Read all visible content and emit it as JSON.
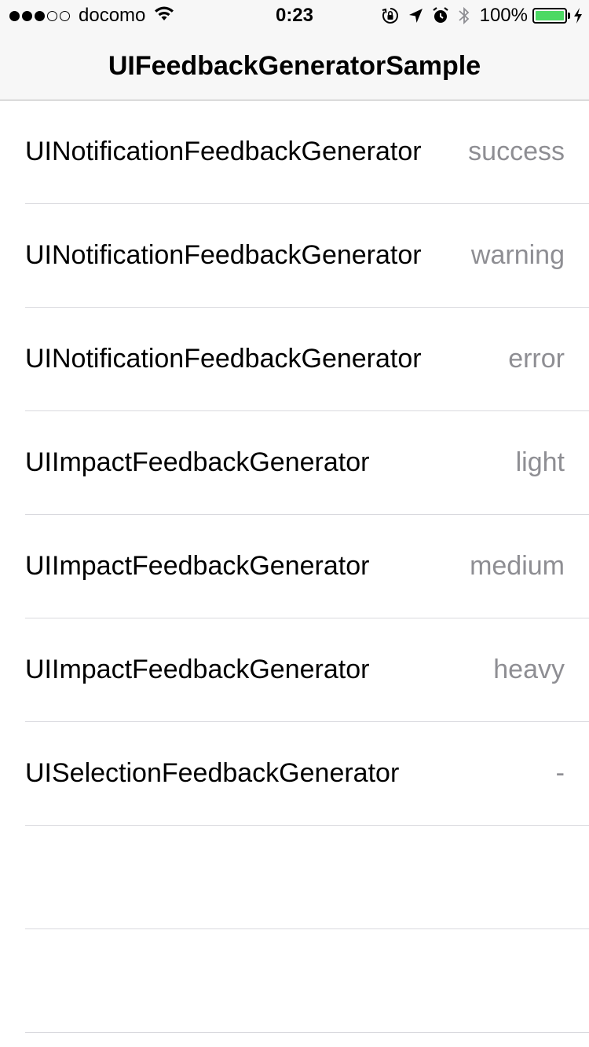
{
  "status_bar": {
    "carrier": "docomo",
    "signal_bars_full": 3,
    "signal_bars_total": 5,
    "time": "0:23",
    "battery_percent": "100%",
    "icons": [
      "wifi-icon",
      "rotation-lock-icon",
      "location-arrow-icon",
      "alarm-icon",
      "bluetooth-icon",
      "battery-icon",
      "charging-bolt-icon"
    ],
    "battery_fill_color": "#4cd964"
  },
  "nav": {
    "title": "UIFeedbackGeneratorSample"
  },
  "rows": [
    {
      "title": "UINotificationFeedbackGenerator",
      "detail": "success"
    },
    {
      "title": "UINotificationFeedbackGenerator",
      "detail": "warning"
    },
    {
      "title": "UINotificationFeedbackGenerator",
      "detail": "error"
    },
    {
      "title": "UIImpactFeedbackGenerator",
      "detail": "light"
    },
    {
      "title": "UIImpactFeedbackGenerator",
      "detail": "medium"
    },
    {
      "title": "UIImpactFeedbackGenerator",
      "detail": "heavy"
    },
    {
      "title": "UISelectionFeedbackGenerator",
      "detail": "-"
    },
    {
      "title": "",
      "detail": ""
    },
    {
      "title": "",
      "detail": ""
    }
  ],
  "colors": {
    "detail_text": "#8e8e93",
    "separator": "#d9d9de",
    "nav_background": "#f7f7f7"
  }
}
